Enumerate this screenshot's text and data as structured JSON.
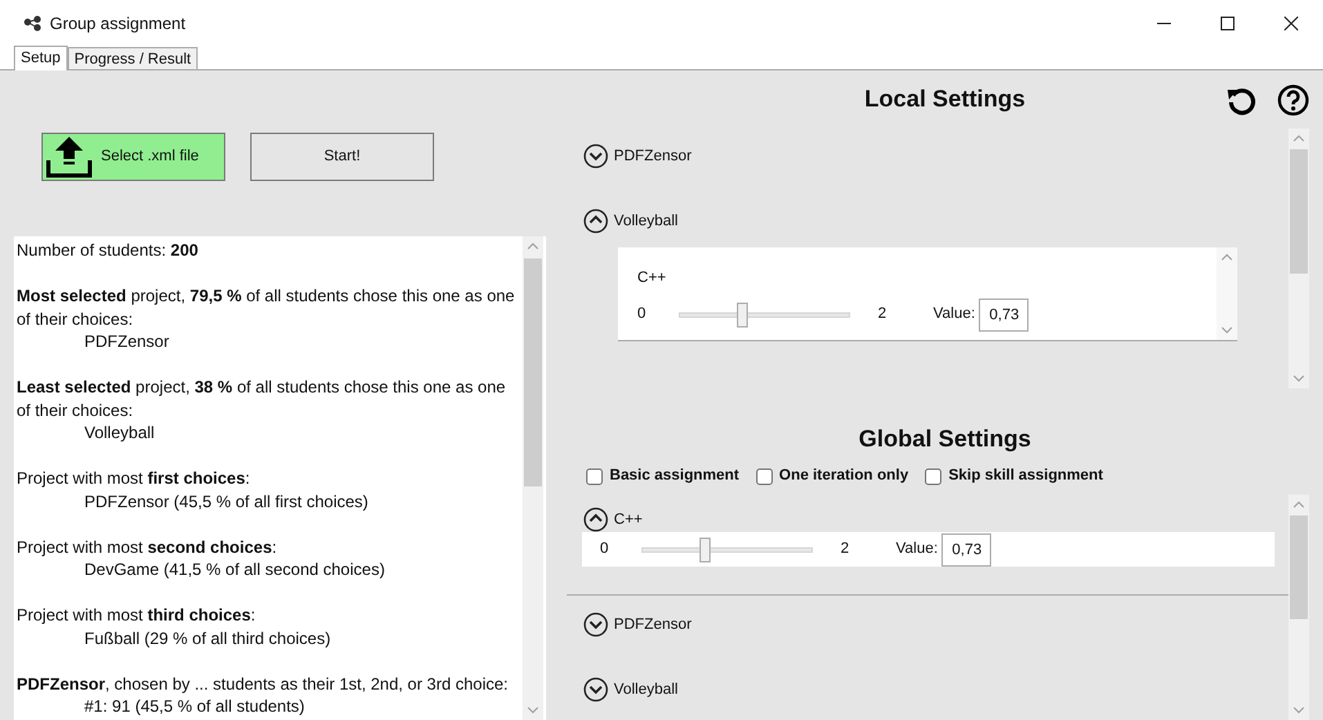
{
  "window": {
    "title": "Group assignment"
  },
  "tabs": [
    {
      "label": "Setup",
      "selected": true
    },
    {
      "label": "Progress / Result",
      "selected": false
    }
  ],
  "buttons": [
    {
      "kind": "upload",
      "label": "Select .xml file"
    },
    {
      "kind": "plain",
      "label": "Start!"
    }
  ],
  "stats": [
    {
      "text": "Number of students: **200**"
    },
    {
      "text": "**Most selected** project, **79,5 %** of all students chose this one as one of their choices:",
      "detail": "PDFZensor"
    },
    {
      "text": "**Least selected** project, **38 %** of all students chose this one as one of their choices:",
      "detail": "Volleyball"
    },
    {
      "text": "Project with most **first choices**:",
      "detail": "PDFZensor (45,5 % of all first choices)"
    },
    {
      "text": "Project with most **second choices**:",
      "detail": "DevGame (41,5 % of all second choices)"
    },
    {
      "text": "Project with most **third choices**:",
      "detail": "Fußball (29 % of all third choices)"
    },
    {
      "text": "**PDFZensor**, chosen by ... students as their 1st, 2nd, or 3rd choice:",
      "detail": "#1: 91 (45,5 % of all students)"
    }
  ],
  "local_settings": {
    "title": "Local Settings",
    "projects": [
      {
        "name": "PDFZensor",
        "expanded": false
      },
      {
        "name": "Volleyball",
        "expanded": true,
        "skills": [
          {
            "name": "C++",
            "min": "0",
            "max": "2",
            "level": 0.365,
            "value_label": "Value:",
            "value": "0,73"
          }
        ]
      }
    ]
  },
  "global_settings": {
    "title": "Global Settings",
    "options": [
      {
        "label": "Basic assignment",
        "checked": false
      },
      {
        "label": "One iteration only",
        "checked": false
      },
      {
        "label": "Skip skill assignment",
        "checked": false
      }
    ],
    "skills": [
      {
        "name": "C++",
        "expanded": true,
        "min": "0",
        "max": "2",
        "level": 0.365,
        "value_label": "Value:",
        "value": "0,73"
      }
    ],
    "projects": [
      {
        "name": "PDFZensor",
        "expanded": false
      },
      {
        "name": "Volleyball",
        "expanded": false
      }
    ]
  }
}
